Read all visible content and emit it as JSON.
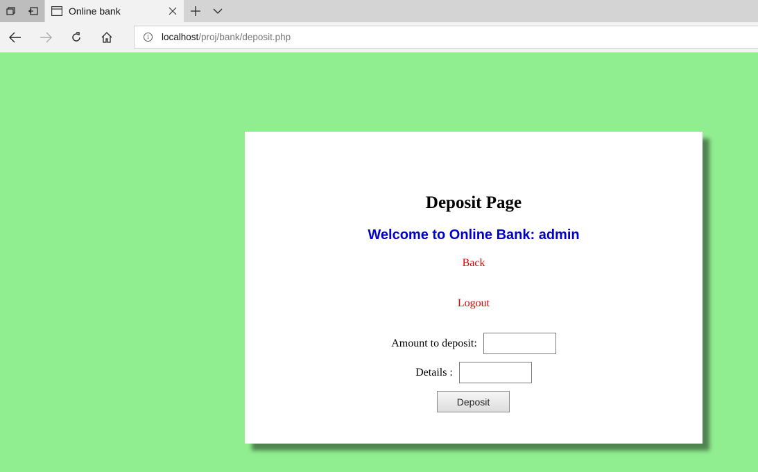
{
  "browser": {
    "tab_title": "Online bank",
    "url_host": "localhost",
    "url_path": "/proj/bank/deposit.php"
  },
  "page": {
    "title": "Deposit Page",
    "welcome": "Welcome to Online Bank: admin",
    "back_label": "Back",
    "logout_label": "Logout",
    "amount_label": "Amount to deposit:",
    "amount_value": "",
    "details_label": "Details :",
    "details_value": "",
    "deposit_button": "Deposit"
  },
  "colors": {
    "background": "#90ee90",
    "welcome": "#0000cd",
    "links": "#e00000"
  }
}
